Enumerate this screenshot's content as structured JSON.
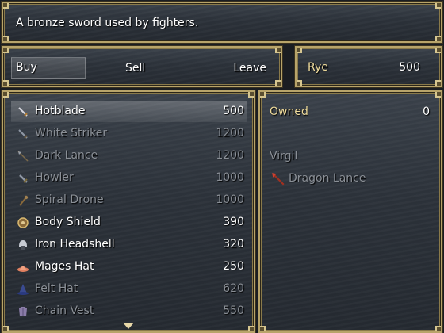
{
  "help": {
    "text": "A bronze sword used by fighters."
  },
  "commands": [
    {
      "label": "Buy"
    },
    {
      "label": "Sell"
    },
    {
      "label": "Leave"
    }
  ],
  "gold": {
    "unit": "Rye",
    "value": "500"
  },
  "items": [
    {
      "name": "Hotblade",
      "price": "500",
      "icon": "sword-icon",
      "enabled": true
    },
    {
      "name": "White Striker",
      "price": "1200",
      "icon": "sword-icon",
      "enabled": false
    },
    {
      "name": "Dark Lance",
      "price": "1200",
      "icon": "spear-icon",
      "enabled": false
    },
    {
      "name": "Howler",
      "price": "1000",
      "icon": "sword-icon",
      "enabled": false
    },
    {
      "name": "Spiral Drone",
      "price": "1000",
      "icon": "staff-icon",
      "enabled": false
    },
    {
      "name": "Body Shield",
      "price": "390",
      "icon": "shield-icon",
      "enabled": true
    },
    {
      "name": "Iron Headshell",
      "price": "320",
      "icon": "helmet-icon",
      "enabled": true
    },
    {
      "name": "Mages Hat",
      "price": "250",
      "icon": "hat-icon",
      "enabled": true
    },
    {
      "name": "Felt Hat",
      "price": "620",
      "icon": "wizard-hat-icon",
      "enabled": false
    },
    {
      "name": "Chain Vest",
      "price": "550",
      "icon": "armor-icon",
      "enabled": false
    }
  ],
  "status": {
    "owned_label": "Owned",
    "owned_value": "0",
    "actor_name": "Virgil",
    "equipped_name": "Dragon Lance",
    "equipped_icon": "spear-icon"
  },
  "colors": {
    "frame": "#b8a46a",
    "window_bg": "#2c323a",
    "text": "#ffffff",
    "disabled_text": "#8a8f96",
    "system_text": "#f0dc9c"
  }
}
